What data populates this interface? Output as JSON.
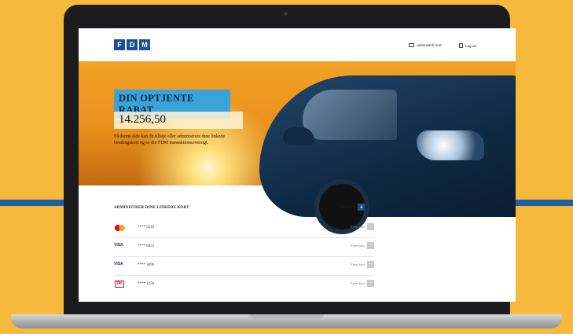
{
  "colors": {
    "background": "#f6b93b",
    "brand": "#1f4f8f",
    "hero_title_bg": "#3aa3d8"
  },
  "logo": {
    "letters": [
      "F",
      "D",
      "M"
    ]
  },
  "nav": {
    "manage_cards": "Administrér kort",
    "logout": "Log ud"
  },
  "hero": {
    "title": "DIN OPTJENTE RABAT",
    "amount": "14.256,50",
    "description": "På denne side kan du tilføje eller administrere dine linkede betalingskort og se din FDM transaktionsoversigt."
  },
  "cards": {
    "title": "ADMINISTRER DINE LINKEDE KORT",
    "add_label": "Tilføj kort",
    "remove_label": "Fjern kort",
    "items": [
      {
        "brand": "mastercard",
        "number": "**** 9110"
      },
      {
        "brand": "VISA",
        "number": "**** 8452"
      },
      {
        "brand": "VISA",
        "number": "**** 3896"
      },
      {
        "brand": "dankort",
        "number": "**** 1256"
      }
    ]
  }
}
